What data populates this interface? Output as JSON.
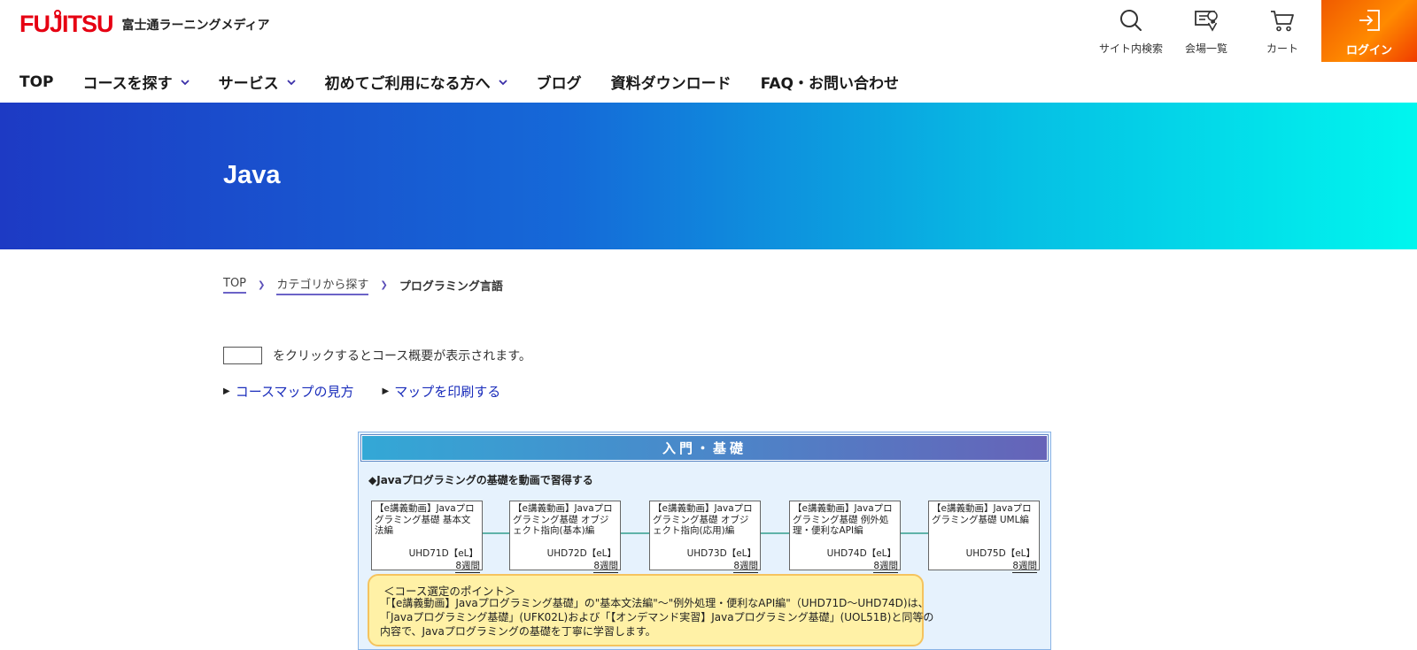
{
  "header": {
    "logo_mark": "FUJITSU",
    "logo_text": "富士通ラーニングメディア",
    "utilities": {
      "search": "サイト内検索",
      "venues": "会場一覧",
      "cart": "カート",
      "login": "ログイン"
    },
    "login_color": "#ff6a00"
  },
  "nav": {
    "items": [
      {
        "label": "TOP",
        "has_dropdown": false
      },
      {
        "label": "コースを探す",
        "has_dropdown": true
      },
      {
        "label": "サービス",
        "has_dropdown": true
      },
      {
        "label": "初めてご利用になる方へ",
        "has_dropdown": true
      },
      {
        "label": "ブログ",
        "has_dropdown": false
      },
      {
        "label": "資料ダウンロード",
        "has_dropdown": false
      },
      {
        "label": "FAQ・お問い合わせ",
        "has_dropdown": false
      }
    ]
  },
  "banner": {
    "title": "Java",
    "colors": [
      "#1d3ac4",
      "#00f6ee"
    ]
  },
  "breadcrumb": {
    "items": [
      "TOP",
      "カテゴリから探す"
    ],
    "current": "プログラミング言語"
  },
  "content": {
    "hint_text": "をクリックするとコース概要が表示されます。",
    "links": [
      "コースマップの見方",
      "マップを印刷する"
    ],
    "link_color": "#1a2dbb"
  },
  "course_map": {
    "header": "入門・基礎",
    "subtitle": "◆Javaプログラミングの基礎を動画で習得する",
    "courses": [
      {
        "title": "【e講義動画】Javaプログラミング基礎 基本文法編",
        "code": "UHD71D【eL】",
        "duration": "8週間"
      },
      {
        "title": "【e講義動画】Javaプログラミング基礎 オブジェクト指向(基本)編",
        "code": "UHD72D【eL】",
        "duration": "8週間"
      },
      {
        "title": "【e講義動画】Javaプログラミング基礎 オブジェクト指向(応用)編",
        "code": "UHD73D【eL】",
        "duration": "8週間"
      },
      {
        "title": "【e講義動画】Javaプログラミング基礎 例外処理・便利なAPI編",
        "code": "UHD74D【eL】",
        "duration": "8週間"
      },
      {
        "title": "【e講義動画】Javaプログラミング基礎 UML編",
        "code": "UHD75D【eL】",
        "duration": "8週間"
      }
    ],
    "note": {
      "title": "＜コース選定のポイント＞",
      "lines": [
        "「【e講義動画】Javaプログラミング基礎」の\"基本文法編\"～\"例外処理・便利なAPI編\"（UHD71D～UHD74D)は、",
        "「Javaプログラミング基礎」(UFK02L)および「【オンデマンド実習】Javaプログラミング基礎」(UOL51B)と同等の",
        "内容で、Javaプログラミングの基礎を丁寧に学習します。"
      ]
    }
  }
}
